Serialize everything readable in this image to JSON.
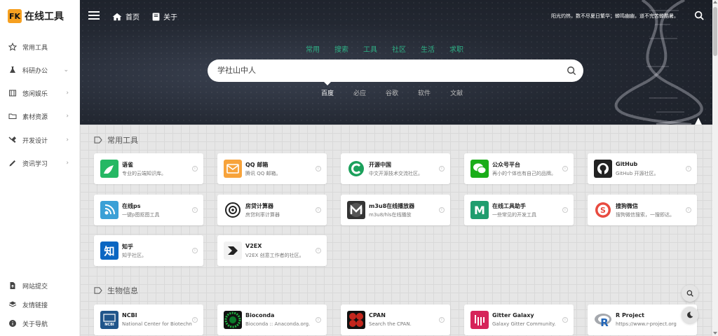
{
  "brand": {
    "badge": "FK",
    "name": "在线工具"
  },
  "sidebar": {
    "items": [
      {
        "label": "常用工具",
        "icon": "star-icon",
        "has_submenu": false
      },
      {
        "label": "科研办公",
        "icon": "flask-icon",
        "has_submenu": true
      },
      {
        "label": "悠闲娱乐",
        "icon": "film-icon",
        "has_submenu": true
      },
      {
        "label": "素材资源",
        "icon": "folder-icon",
        "has_submenu": true
      },
      {
        "label": "开发设计",
        "icon": "tools-icon",
        "has_submenu": true
      },
      {
        "label": "资讯学习",
        "icon": "pencil-icon",
        "has_submenu": true
      }
    ],
    "bottom_items": [
      {
        "label": "网站提交",
        "icon": "file-upload-icon"
      },
      {
        "label": "友情链接",
        "icon": "layers-icon"
      },
      {
        "label": "关于导航",
        "icon": "info-icon"
      }
    ]
  },
  "header": {
    "home_label": "首页",
    "about_label": "关于",
    "motto": "阳光灼热，数不尽夏日繁华；蝉鸣幽幽，道不完苦蝉酷暑。"
  },
  "search": {
    "category_tabs": [
      "常用",
      "搜索",
      "工具",
      "社区",
      "生活",
      "求职"
    ],
    "query": "学社山中人",
    "engine_tabs": [
      "百度",
      "必应",
      "谷歌",
      "软件",
      "文献"
    ],
    "active_engine": "百度"
  },
  "sections": [
    {
      "title": "常用工具",
      "cards": [
        {
          "title": "语雀",
          "desc": "专业的云端知识库。",
          "icon": "yuque-icon",
          "color": "#25b864"
        },
        {
          "title": "QQ 邮箱",
          "desc": "腾讯 QQ 邮箱。",
          "icon": "mail-icon",
          "color": "#f7a33b"
        },
        {
          "title": "开源中国",
          "desc": "中文开源技术交流社区。",
          "icon": "oschina-icon",
          "color": "#1ba05b"
        },
        {
          "title": "公众号平台",
          "desc": "再小的个体也有自己的品牌。",
          "icon": "wechat-icon",
          "color": "#1aad19"
        },
        {
          "title": "GitHub",
          "desc": "GitHub 开源社区。",
          "icon": "github-icon",
          "color": "#222222"
        },
        {
          "title": "在线ps",
          "desc": "一键p图抠图工具",
          "icon": "ps-icon",
          "color": "#3ba0d6"
        },
        {
          "title": "房贷计算器",
          "desc": "房贷利率计算器",
          "icon": "calculator-icon",
          "color": "#ffffff"
        },
        {
          "title": "m3u8在线播放器",
          "desc": "m3u8/hls在线播放",
          "icon": "m3u8-icon",
          "color": "#333333"
        },
        {
          "title": "在线工具助手",
          "desc": "一些常见的开发工具",
          "icon": "m-tool-icon",
          "color": "#1f9d6e"
        },
        {
          "title": "搜狗微信",
          "desc": "搜狗微信搜索，一搜即达。",
          "icon": "sogou-icon",
          "color": "#e84a3f"
        },
        {
          "title": "知乎",
          "desc": "知乎社区。",
          "icon": "zhihu-icon",
          "color": "#0a66c2"
        },
        {
          "title": "V2EX",
          "desc": "V2EX 创意工作者的社区。",
          "icon": "v2ex-icon",
          "color": "#ffffff"
        }
      ]
    },
    {
      "title": "生物信息",
      "cards": [
        {
          "title": "NCBI",
          "desc": "National Center for Biotechnology",
          "icon": "ncbi-icon",
          "color": "#20558a"
        },
        {
          "title": "Bioconda",
          "desc": "Bioconda :: Anaconda.org.",
          "icon": "bioconda-icon",
          "color": "#0b7a2a"
        },
        {
          "title": "CPAN",
          "desc": "Search the CPAN.",
          "icon": "cpan-icon",
          "color": "#c4261d"
        },
        {
          "title": "Gitter Galaxy",
          "desc": "Galaxy Gitter Community.",
          "icon": "gitter-icon",
          "color": "#d6245a"
        },
        {
          "title": "R Project",
          "desc": "https://www.r-project.org",
          "icon": "r-project-icon",
          "color": "#2266b8"
        }
      ]
    }
  ]
}
